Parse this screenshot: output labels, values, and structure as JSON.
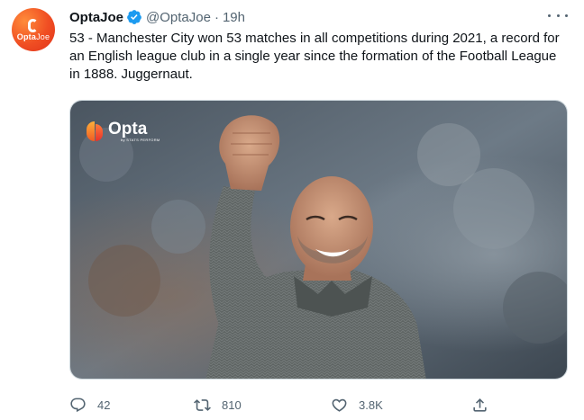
{
  "avatar": {
    "brand": "Opta",
    "suffix": "Joe"
  },
  "tweet": {
    "display_name": "OptaJoe",
    "handle": "@OptaJoe",
    "separator": "·",
    "time": "19h",
    "text": "53 - Manchester City won 53 matches in all competitions during 2021, a record for an English league club in a single year since the formation of the Football League in 1888. Juggernaut."
  },
  "media": {
    "logo_text": "Opta",
    "logo_subtext": "by STATS PERFORM"
  },
  "actions": {
    "replies": "42",
    "retweets": "810",
    "likes": "3.8K"
  },
  "colors": {
    "verified": "#1d9bf0",
    "brand_orange": "#f04e23",
    "muted_text": "#536471"
  }
}
